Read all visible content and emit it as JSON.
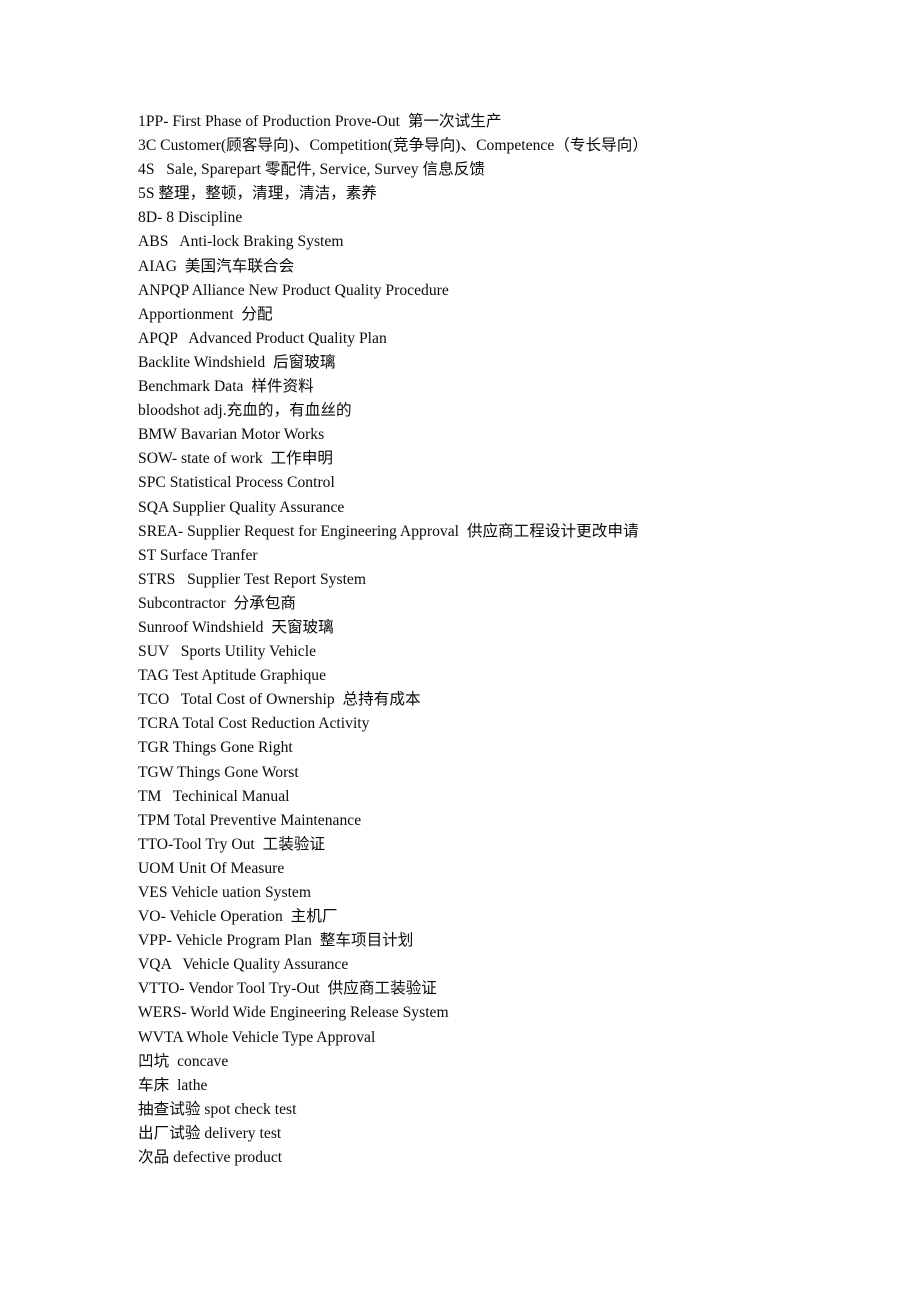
{
  "document": {
    "background_color": "#ffffff",
    "text_color": "#0b0b0b",
    "lines": [
      "1PP- First Phase of Production Prove-Out  第一次试生产",
      "3C Customer(顾客导向)、Competition(竞争导向)、Competence（专长导向）",
      "4S   Sale, Sparepart 零配件, Service, Survey 信息反馈",
      "5S 整理，整顿，清理，清洁，素养",
      "8D- 8 Discipline",
      "ABS   Anti-lock Braking System",
      "AIAG  美国汽车联合会",
      "ANPQP Alliance New Product Quality Procedure",
      "Apportionment  分配",
      "APQP   Advanced Product Quality Plan",
      "Backlite Windshield  后窗玻璃",
      "Benchmark Data  样件资料",
      "bloodshot adj.充血的，有血丝的",
      "BMW Bavarian Motor Works",
      "SOW- state of work  工作申明",
      "SPC Statistical Process Control",
      "SQA Supplier Quality Assurance",
      "SREA- Supplier Request for Engineering Approval  供应商工程设计更改申请",
      "ST Surface Tranfer",
      "STRS   Supplier Test Report System",
      "Subcontractor  分承包商",
      "Sunroof Windshield  天窗玻璃",
      "SUV   Sports Utility Vehicle",
      "TAG Test Aptitude Graphique",
      "TCO   Total Cost of Ownership  总持有成本",
      "TCRA Total Cost Reduction Activity",
      "TGR Things Gone Right",
      "TGW Things Gone Worst",
      "TM   Techinical Manual",
      "TPM Total Preventive Maintenance",
      "TTO-Tool Try Out  工装验证",
      "UOM Unit Of Measure",
      "VES Vehicle uation System",
      "VO- Vehicle Operation  主机厂",
      "VPP- Vehicle Program Plan  整车项目计划",
      "VQA   Vehicle Quality Assurance",
      "VTTO- Vendor Tool Try-Out  供应商工装验证",
      "WERS- World Wide Engineering Release System",
      "WVTA Whole Vehicle Type Approval",
      "凹坑  concave",
      "车床  lathe",
      "抽查试验 spot check test",
      "出厂试验 delivery test",
      "次品 defective product"
    ]
  }
}
